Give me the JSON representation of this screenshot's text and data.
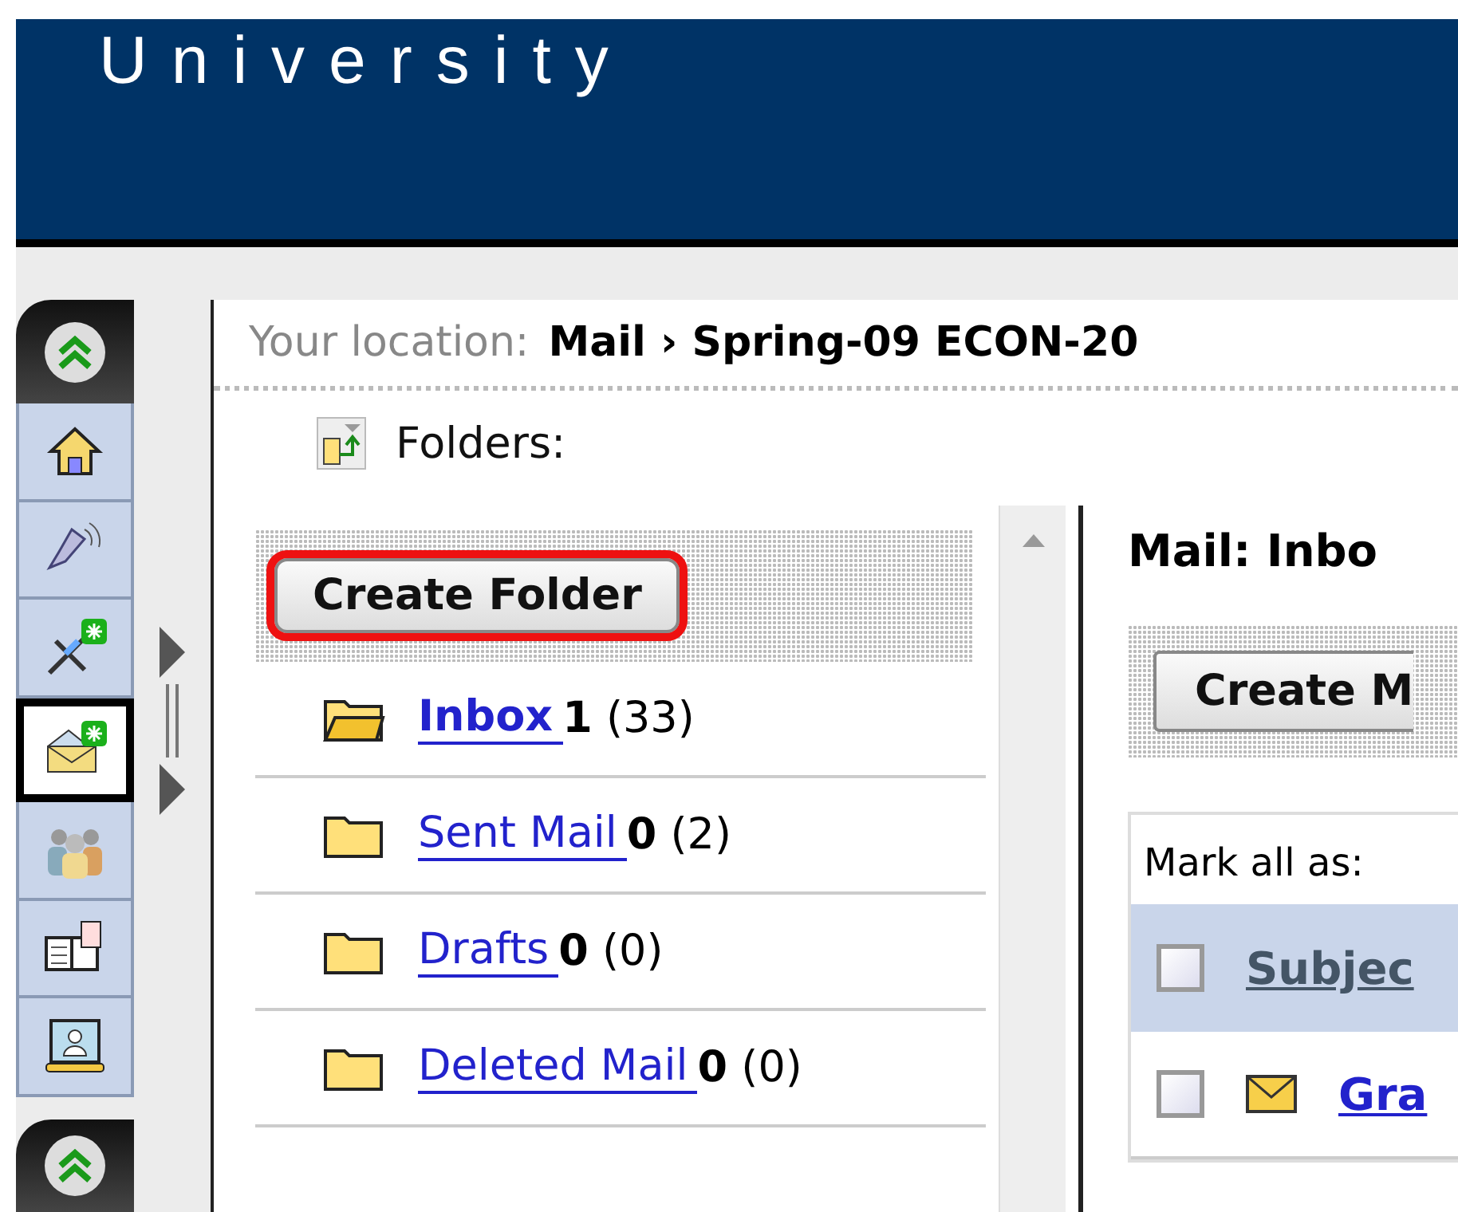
{
  "header": {
    "title": "University"
  },
  "rail": {
    "items": [
      {
        "kind": "home",
        "selected": false
      },
      {
        "kind": "speaker",
        "selected": false
      },
      {
        "kind": "tool",
        "selected": false
      },
      {
        "kind": "mail",
        "selected": true
      },
      {
        "kind": "people",
        "selected": false
      },
      {
        "kind": "book",
        "selected": false
      },
      {
        "kind": "screen",
        "selected": false
      }
    ]
  },
  "breadcrumb": {
    "label": "Your location:",
    "path": "Mail › Spring-09 ECON-20"
  },
  "folders": {
    "label": "Folders:",
    "button": "Create Folder",
    "button_highlighted": true,
    "items": [
      {
        "name": "Inbox",
        "unread": "1",
        "total": "(33)",
        "selected": true
      },
      {
        "name": "Sent Mail",
        "unread": "0",
        "total": "(2)",
        "selected": false
      },
      {
        "name": "Drafts",
        "unread": "0",
        "total": "(0)",
        "selected": false
      },
      {
        "name": "Deleted Mail",
        "unread": "0",
        "total": "(0)",
        "selected": false
      }
    ]
  },
  "mail": {
    "title": "Mail: Inbo",
    "button": "Create M",
    "mark_all_label": "Mark all as:",
    "header": {
      "checked": false,
      "column": "Subjec"
    },
    "rows": [
      {
        "checked": false,
        "subject": "Gra"
      }
    ]
  }
}
